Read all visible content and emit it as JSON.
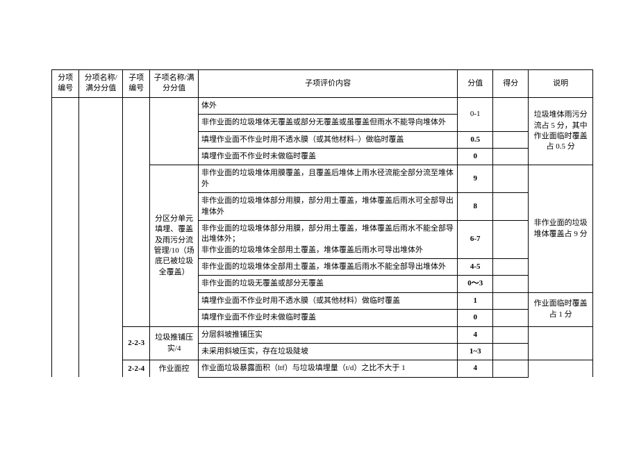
{
  "header": {
    "col1": "分项编号",
    "col2": "分项名称/满分分值",
    "col3": "子项编号",
    "col4": "子项名称/满分分值",
    "col5": "子项评价内容",
    "col6": "分值",
    "col7": "得分",
    "col8": "说明"
  },
  "rows": {
    "r1_c5": "体外",
    "r2_c5": "非作业面的垃圾堆体无覆盖或部分无覆盖或虽覆盖但雨水不能导向堆体外",
    "r2_c6": "0-1",
    "r3_c5": "填埋作业面不作业时用不透水膜（或其他材料–）做临时覆盖",
    "r3_c6": "0.5",
    "r3_c8": "垃圾堆体雨污分流占 5 分，其中作业面临时覆盖占 0.5 分",
    "r4_c5": "填埋作业面不作业时未做临时覆盖",
    "r4_c6": "0",
    "g2_c4": "分区分单元填埋、覆盖及雨污分流管理/10（场底已被垃圾全覆盖）",
    "r5_c5": "非作业面的垃圾堆体用膜覆盖，且覆盖后堆体上雨水径流能全部分流至堆体外",
    "r5_c6": "9",
    "r6_c5": "非作业面的垃圾堆体部分用膜，部分用土覆盖，堆体覆盖后雨水可全部导出堆体外",
    "r6_c6": "8",
    "r7_c5a": "非作业面的垃圾堆体部分用膜，部分用土覆盖，堆体覆盖后雨水不能全部导出堆体外；",
    "r7_c5b": "非作业面的垃圾堆体全部用土覆盖，堆体覆盖后雨水可导出堆体外",
    "r7_c6": "6-7",
    "g2_c8": "非作业面的垃圾堆体覆盖占 9 分",
    "r8_c5": "非作业面的垃圾堆体全部用土覆盖，堆体覆盖后雨水不能全部导出堆体外",
    "r8_c6": "4-5",
    "r9_c5": "非作业面的垃圾无覆盖或部分无覆盖",
    "r9_c6": "0～3",
    "r10_c5": "填埋作业面不作业时用不透水膜（或其他材料）做临时覆盖",
    "r10_c6": "1",
    "r10_c8": "作业面临时覆盖占 1 分",
    "r11_c5": "填埋作业面不作业时未做临时覆盖",
    "r11_c6": "0",
    "r12_c3": "2-2-3",
    "r12_c4": "垃圾推铺压实/4",
    "r12_c5": "分层斜坡推铺压实",
    "r12_c6": "4",
    "r13_c5": "未采用斜坡压实，存在垃圾陡坡",
    "r13_c6": "1~3",
    "r14_c3": "2-2-4",
    "r14_c4": "作业面控",
    "r14_c5": "作业面垃圾暴露面积（ltf）与垃圾填埋量（t/d）之比不大于 1",
    "r14_c6": "4"
  }
}
